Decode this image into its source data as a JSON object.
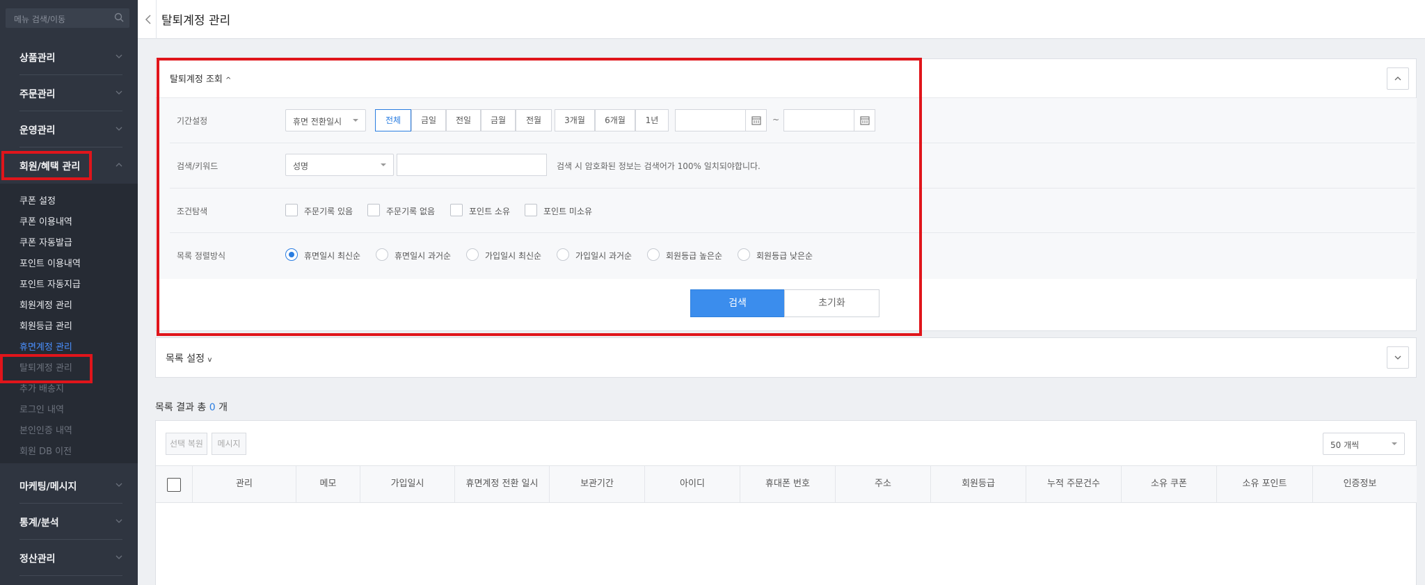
{
  "sidebar": {
    "search_placeholder": "메뉴 검색/이동",
    "groups": [
      {
        "label": "상품관리"
      },
      {
        "label": "주문관리"
      },
      {
        "label": "운영관리"
      },
      {
        "label": "회원/혜택 관리"
      },
      {
        "label": "마케팅/메시지"
      },
      {
        "label": "통계/분석"
      },
      {
        "label": "정산관리"
      }
    ],
    "submenu": [
      "쿠폰 설정",
      "쿠폰 이용내역",
      "쿠폰 자동발급",
      "포인트 이용내역",
      "포인트 자동지급",
      "회원계정 관리",
      "회원등급 관리",
      "휴면계정 관리",
      "탈퇴계정 관리",
      "추가 배송지",
      "로그인 내역",
      "본인인증 내역",
      "회원 DB 이전"
    ]
  },
  "topbar": {
    "title": "탈퇴계정 관리"
  },
  "filter": {
    "title": "탈퇴계정 조회",
    "period_label": "기간설정",
    "period_type": "휴면 전환일시",
    "period_options": [
      "전체",
      "금일",
      "전일",
      "금월",
      "전월",
      "3개월",
      "6개월",
      "1년"
    ],
    "date_separator": "~",
    "keyword_label": "검색/키워드",
    "keyword_type": "성명",
    "keyword_hint": "검색 시 암호화된 정보는 검색어가 100% 일치되야합니다.",
    "condition_label": "조건탐색",
    "conditions": [
      "주문기록 있음",
      "주문기록 없음",
      "포인트 소유",
      "포인트 미소유"
    ],
    "sort_label": "목록 정렬방식",
    "sort_options": [
      "휴면일시 최신순",
      "휴면일시 과거순",
      "가입일시 최신순",
      "가입일시 과거순",
      "회원등급 높은순",
      "회원등급 낮은순"
    ],
    "search_button": "검색",
    "reset_button": "초기화"
  },
  "list_settings": {
    "title": "목록 설정"
  },
  "results": {
    "prefix": "목록 결과 총",
    "count": "0",
    "suffix": "개"
  },
  "table": {
    "restore_button": "선택 복원",
    "message_button": "메시지",
    "page_size": "50 개씩",
    "columns": [
      "관리",
      "메모",
      "가입일시",
      "휴면계정 전환 일시",
      "보관기간",
      "아이디",
      "휴대폰 번호",
      "주소",
      "회원등급",
      "누적 주문건수",
      "소유 쿠폰",
      "소유 포인트",
      "인증정보"
    ]
  }
}
